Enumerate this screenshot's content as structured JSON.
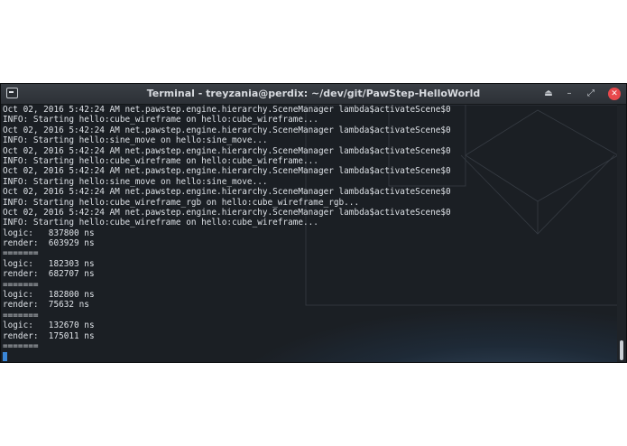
{
  "window": {
    "title": "Terminal - treyzania@perdix: ~/dev/git/PawStep-HelloWorld",
    "controls": {
      "eject": "⏏",
      "minimize": "–",
      "maximize": "⤢",
      "close": "✕"
    }
  },
  "terminal": {
    "lines": [
      "Oct 02, 2016 5:42:24 AM net.pawstep.engine.hierarchy.SceneManager lambda$activateScene$0",
      "INFO: Starting hello:cube_wireframe on hello:cube_wireframe...",
      "Oct 02, 2016 5:42:24 AM net.pawstep.engine.hierarchy.SceneManager lambda$activateScene$0",
      "INFO: Starting hello:sine_move on hello:sine_move...",
      "Oct 02, 2016 5:42:24 AM net.pawstep.engine.hierarchy.SceneManager lambda$activateScene$0",
      "INFO: Starting hello:cube_wireframe on hello:cube_wireframe...",
      "Oct 02, 2016 5:42:24 AM net.pawstep.engine.hierarchy.SceneManager lambda$activateScene$0",
      "INFO: Starting hello:sine_move on hello:sine_move...",
      "Oct 02, 2016 5:42:24 AM net.pawstep.engine.hierarchy.SceneManager lambda$activateScene$0",
      "INFO: Starting hello:cube_wireframe_rgb on hello:cube_wireframe_rgb...",
      "Oct 02, 2016 5:42:24 AM net.pawstep.engine.hierarchy.SceneManager lambda$activateScene$0",
      "INFO: Starting hello:cube_wireframe on hello:cube_wireframe...",
      "logic:   837800 ns",
      "render:  603929 ns",
      "=======",
      "logic:   182303 ns",
      "render:  682707 ns",
      "=======",
      "logic:   182800 ns",
      "render:  75632 ns",
      "=======",
      "logic:   132670 ns",
      "render:  175011 ns",
      "======="
    ]
  },
  "colors": {
    "terminal_bg": "#1b1f24",
    "terminal_fg": "#dde1e6",
    "close_button": "#e8484c",
    "cursor": "#3a86d8"
  }
}
